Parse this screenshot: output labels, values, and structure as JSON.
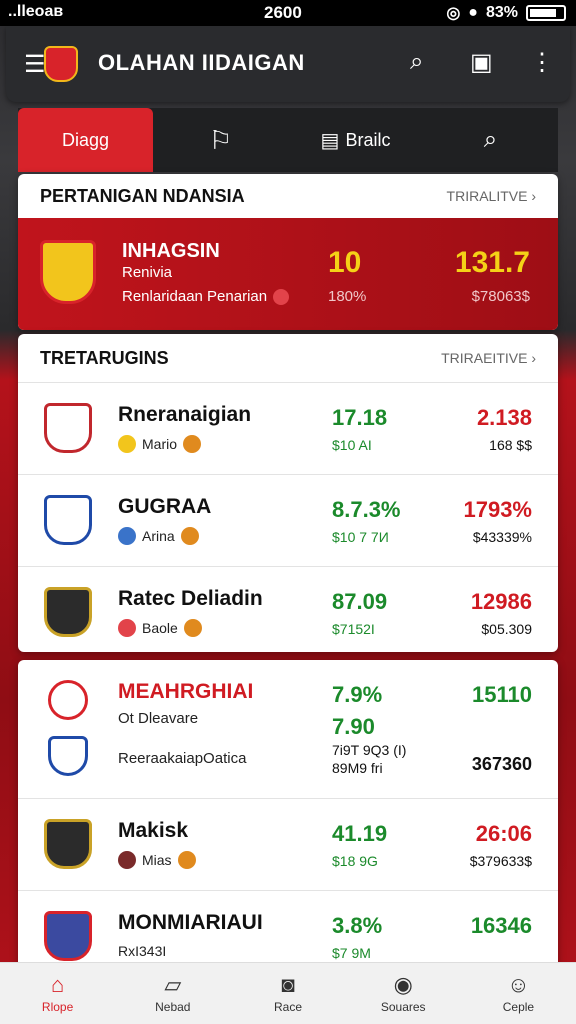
{
  "status": {
    "signal": "..llеoaв",
    "time": "2600",
    "battery": "83%"
  },
  "app_bar": {
    "title": "OLAHAN IIDAIGAN"
  },
  "tabs": [
    {
      "label": "Diagg",
      "icon": ""
    },
    {
      "label": "",
      "icon": "whistle-icon"
    },
    {
      "label": "Brailc",
      "icon": "list-icon"
    },
    {
      "label": "",
      "icon": "search-icon"
    }
  ],
  "section1": {
    "title": "PERTANIGAN NDANSIA",
    "link": "TRIRALITVE ›",
    "featured": {
      "name": "INHAGSIN",
      "sub1": "Renivia",
      "sub2": "Renlaridaan Penarian",
      "v1": "10",
      "v1_sub": "180%",
      "v2": "131.7",
      "v2_sub": "$78063$"
    }
  },
  "section2": {
    "title": "TRETARUGINS",
    "link": "TRIRAEITIVE ›",
    "rows": [
      {
        "name": "Rneranaigian",
        "sub": "Mario",
        "v1": "17.18",
        "v1_sub": "$10 AI",
        "v2": "2.138",
        "v2_sub": "168 $$",
        "v2_color": "#d01b22"
      },
      {
        "name": "GUGRAA",
        "sub": "Arina",
        "v1": "8.7.3%",
        "v1_sub": "$10 7 7И",
        "v2": "1793%",
        "v2_sub": "$43339%",
        "v2_color": "#d01b22"
      },
      {
        "name": "Ratec Deliadin",
        "sub": "Baole",
        "v1": "87.09",
        "v1_sub": "$7152I",
        "v2": "12986",
        "v2_sub": "$05.309",
        "v2_color": "#d01b22"
      }
    ]
  },
  "section3": {
    "rows": [
      {
        "name": "MEAHRGHIAI",
        "sub": "Ot Dleavare",
        "sub2": "ReeraakaiapOatica",
        "v1": "7.9%",
        "v1b": "7.90",
        "v1_sub": "7i9T 9Q3 (I)",
        "v1_sub2": "89M9 fri",
        "v2": "15110",
        "v2_sub": "367360",
        "v2_color": "#1b8a2b"
      },
      {
        "name": "Makisk",
        "sub": "Mias",
        "v1": "41.19",
        "v1_sub": "$18 9G",
        "v2": "26:06",
        "v2_sub": "$379633$",
        "v2_color": "#d01b22"
      },
      {
        "name": "MONMIARIAUI",
        "sub": "RxI343I",
        "v1": "3.8%",
        "v1_sub": "$7 9M",
        "v2": "16346",
        "v2_sub": "",
        "v2_color": "#1b8a2b"
      }
    ]
  },
  "bottom_nav": [
    {
      "label": "Rlope",
      "icon": "home-icon"
    },
    {
      "label": "Nebad",
      "icon": "map-icon"
    },
    {
      "label": "Race",
      "icon": "record-icon"
    },
    {
      "label": "Souares",
      "icon": "badge-icon"
    },
    {
      "label": "Ceple",
      "icon": "person-icon"
    }
  ],
  "colors": {
    "accent": "#d8232a",
    "positive": "#1b8a2b",
    "highlight": "#f5d117"
  }
}
